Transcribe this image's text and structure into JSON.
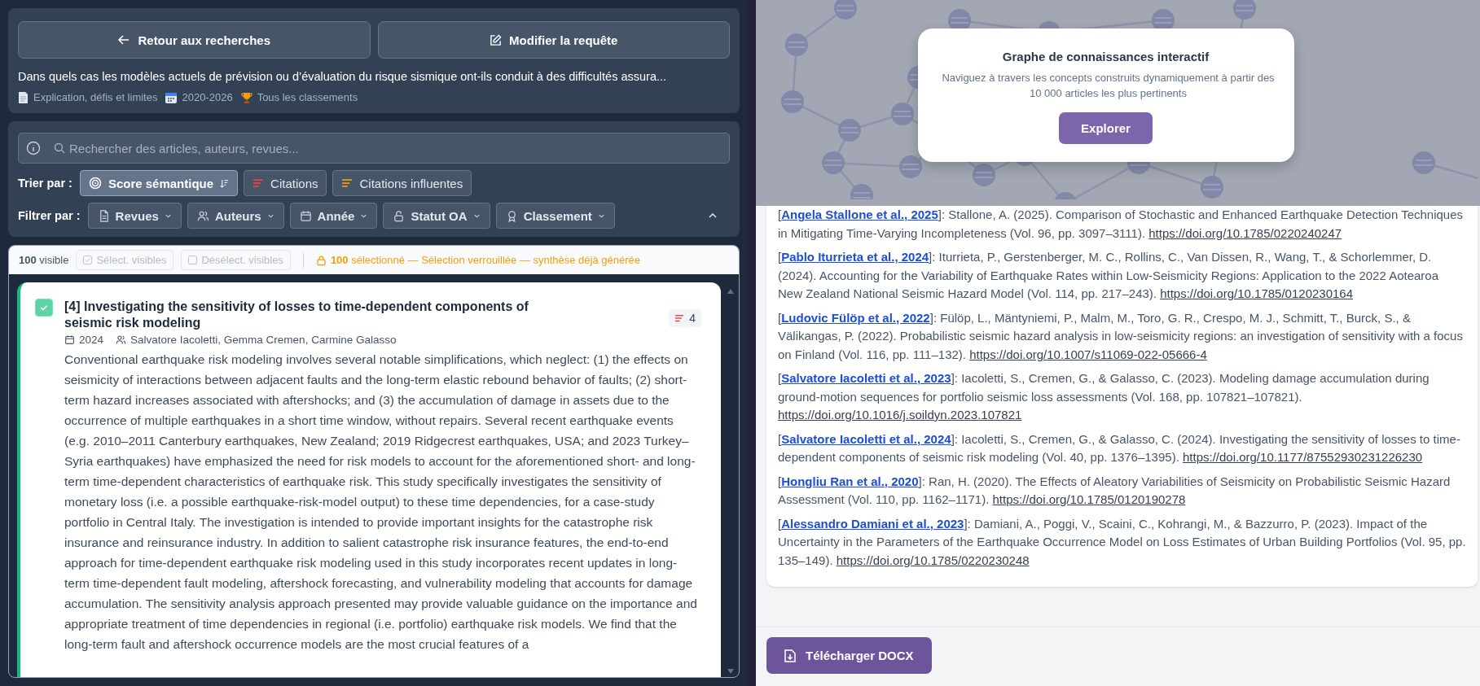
{
  "query_panel": {
    "back_button": "Retour aux recherches",
    "edit_button": "Modifier la requête",
    "question": "Dans quels cas les modèles actuels de prévision ou d’évaluation du risque sismique ont-ils conduit à des difficultés assura...",
    "tags": [
      {
        "kind": "document",
        "label": "Explication, défis et limites"
      },
      {
        "kind": "calendar",
        "label": "2020-2026"
      },
      {
        "kind": "trophy",
        "label": "Tous les classements"
      }
    ]
  },
  "filter_panel": {
    "search": {
      "placeholder": "Rechercher des articles, auteurs, revues..."
    },
    "sort_label": "Trier par :",
    "sort_options": [
      {
        "kind": "semantic",
        "label": "Score sémantique",
        "selected": true
      },
      {
        "kind": "citations",
        "label": "Citations",
        "selected": false
      },
      {
        "kind": "influential",
        "label": "Citations influentes",
        "selected": false
      }
    ],
    "filter_label": "Filtrer par :",
    "filters": [
      {
        "kind": "document",
        "label": "Revues"
      },
      {
        "kind": "users",
        "label": "Auteurs"
      },
      {
        "kind": "calendar",
        "label": "Année"
      },
      {
        "kind": "lock",
        "label": "Statut OA"
      },
      {
        "kind": "award",
        "label": "Classement"
      }
    ],
    "collapsed": false
  },
  "article_list": {
    "visible_count": "**100** visible",
    "actions": [
      {
        "kind": "select",
        "label": "Sélect. visibles",
        "disabled": true
      },
      {
        "kind": "deselect",
        "label": "Désélect. visibles",
        "disabled": true
      }
    ],
    "lock_message": "**100** sélectionné — Sélection verrouillée — synthèse déjà générée",
    "articles": [
      {
        "checked": true,
        "title": "[4] Investigating the sensitivity of losses to time-dependent components of seismic risk modeling",
        "citations": "4",
        "year": "2024",
        "authors": "Salvatore Iacoletti, Gemma Cremen, Carmine Galasso",
        "abstract": "Conventional earthquake risk modeling involves several notable simplifications, which neglect: (1) the effects on seismicity of interactions between adjacent faults and the long-term elastic rebound behavior of faults; (2) short-term hazard increases associated with aftershocks; and (3) the accumulation of damage in assets due to the occurrence of multiple earthquakes in a short time window, without repairs. Several recent earthquake events (e.g. 2010–2011 Canterbury earthquakes, New Zealand; 2019 Ridgecrest earthquakes, USA; and 2023 Turkey–Syria earthquakes) have emphasized the need for risk models to account for the aforementioned short- and long-term time-dependent characteristics of earthquake risk. This study specifically investigates the sensitivity of monetary loss (i.e. a possible earthquake-risk-model output) to these time dependencies, for a case-study portfolio in Central Italy. The investigation is intended to provide important insights for the catastrophe risk insurance and reinsurance industry. In addition to salient catastrophe risk insurance features, the end-to-end approach for time-dependent earthquake risk modeling used in this study incorporates recent updates in long-term time-dependent fault modeling, aftershock forecasting, and vulnerability modeling that accounts for damage accumulation. The sensitivity analysis approach presented may provide valuable guidance on the importance and appropriate treatment of time dependencies in regional (i.e. portfolio) earthquake risk models. We find that the long-term fault and aftershock occurrence models are the most crucial features of a"
      }
    ]
  },
  "graph_banner": {
    "title": "Graphe de connaissances interactif",
    "description": "Naviguez à travers les concepts construits dynamiquement à partir des 10 000 articles les plus pertinents",
    "button": "Explorer"
  },
  "references": [
    {
      "before": "[",
      "citation": "Angela Stallone et al., 2025",
      "after": "]: Stallone, A. (2025). Comparison of Stochastic and Enhanced Earthquake Detection Techniques in Mitigating Time-Varying Incompleteness (Vol. 96, pp. 3097–3111). ",
      "doi": "https://doi.org/10.1785/0220240247"
    },
    {
      "before": "[",
      "citation": "Pablo Iturrieta et al., 2024",
      "after": "]: Iturrieta, P., Gerstenberger, M. C., Rollins, C., Van Dissen, R., Wang, T., & Schorlemmer, D. (2024). Accounting for the Variability of Earthquake Rates within Low-Seismicity Regions: Application to the 2022 Aotearoa New Zealand National Seismic Hazard Model (Vol. 114, pp. 217–243). ",
      "doi": "https://doi.org/10.1785/0120230164"
    },
    {
      "before": "[",
      "citation": "Ludovic Fülöp et al., 2022",
      "after": "]: Fülöp, L., Mäntyniemi, P., Malm, M., Toro, G. R., Crespo, M. J., Schmitt, T., Burck, S., & Välikangas, P. (2022). Probabilistic seismic hazard analysis in low-seismicity regions: an investigation of sensitivity with a focus on Finland (Vol. 116, pp. 111–132). ",
      "doi": "https://doi.org/10.1007/s11069-022-05666-4"
    },
    {
      "before": "[",
      "citation": "Salvatore Iacoletti et al., 2023",
      "after": "]: Iacoletti, S., Cremen, G., & Galasso, C. (2023). Modeling damage accumulation during ground-motion sequences for portfolio seismic loss assessments (Vol. 168, pp. 107821–107821). ",
      "doi": "https://doi.org/10.1016/j.soildyn.2023.107821"
    },
    {
      "before": "[",
      "citation": "Salvatore Iacoletti et al., 2024",
      "after": "]: Iacoletti, S., Cremen, G., & Galasso, C. (2024). Investigating the sensitivity of losses to time-dependent components of seismic risk modeling (Vol. 40, pp. 1376–1395). ",
      "doi": "https://doi.org/10.1177/87552930231226230"
    },
    {
      "before": "[",
      "citation": "Hongliu Ran et al., 2020",
      "after": "]: Ran, H. (2020). The Effects of Aleatory Variabilities of Seismicity on Probabilistic Seismic Hazard Assessment (Vol. 110, pp. 1162–1171). ",
      "doi": "https://doi.org/10.1785/0120190278"
    },
    {
      "before": "[",
      "citation": "Alessandro Damiani et al., 2023",
      "after": "]: Damiani, A., Poggi, V., Scaini, C., Kohrangi, M., & Bazzurro, P. (2023). Impact of the Uncertainty in the Parameters of the Earthquake Occurrence Model on Loss Estimates of Urban Building Portfolios (Vol. 95, pp. 135–149). ",
      "doi": "https://doi.org/10.1785/0220230248"
    }
  ],
  "export_button": "Télécharger DOCX"
}
